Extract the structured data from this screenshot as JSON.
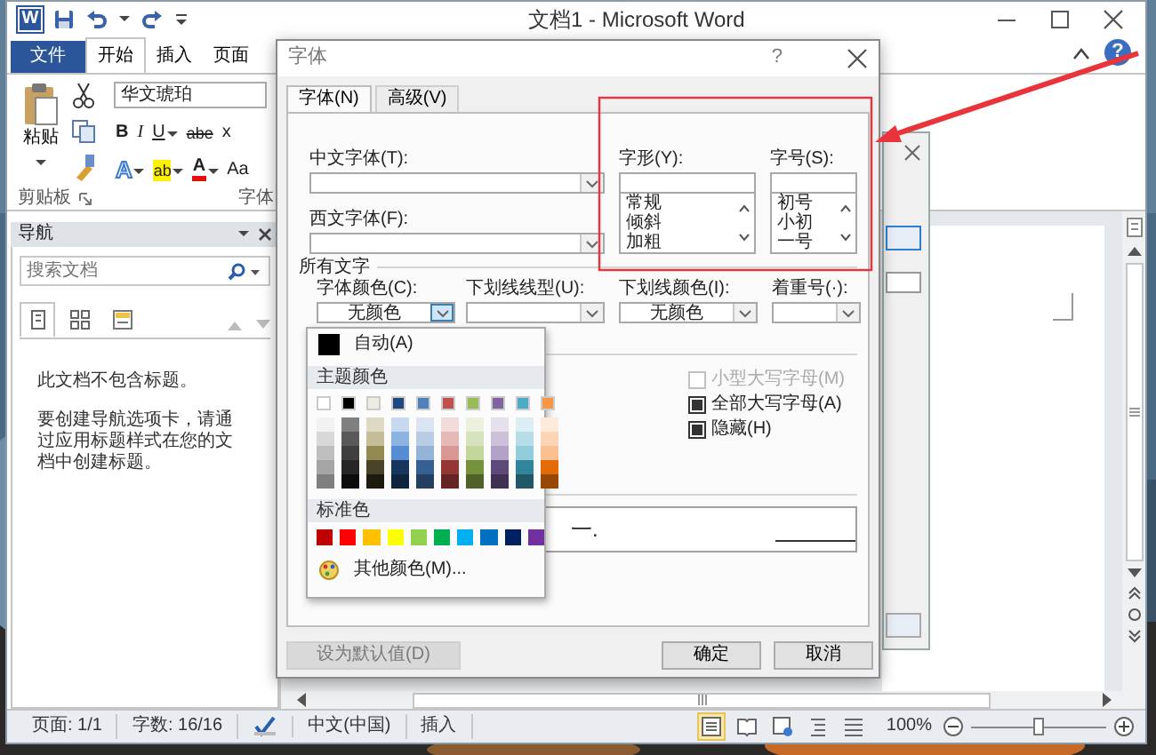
{
  "window": {
    "app_badge": "W",
    "title": "文档1 - Microsoft Word"
  },
  "ribbon_tabs": [
    {
      "label": "文件",
      "kind": "file",
      "selected": false
    },
    {
      "label": "开始",
      "kind": "tab",
      "selected": true
    },
    {
      "label": "插入",
      "kind": "tab",
      "selected": false
    },
    {
      "label": "页面",
      "kind": "tab",
      "selected": false
    }
  ],
  "ribbon": {
    "help": "?",
    "paste_label": "粘贴",
    "font_name": "华文琥珀",
    "format_row1": [
      {
        "kind": "bold",
        "text": "B",
        "menu": false
      },
      {
        "kind": "italic",
        "text": "I",
        "menu": false
      },
      {
        "kind": "underline",
        "text": "U",
        "menu": true
      },
      {
        "kind": "strike",
        "text": "abe",
        "menu": false
      },
      {
        "kind": "plain",
        "text": "x",
        "menu": false
      }
    ],
    "format_row2": [
      {
        "kind": "effects",
        "text": "A",
        "menu": true
      },
      {
        "kind": "highlight",
        "text": "ab",
        "menu": true
      },
      {
        "kind": "color",
        "text": "A",
        "menu": true
      },
      {
        "kind": "plain",
        "text": "Aa",
        "menu": false
      }
    ],
    "groups": [
      "剪贴板",
      "字体"
    ]
  },
  "navigation": {
    "title": "导航",
    "search_placeholder": "搜索文档",
    "tabs": [
      {
        "kind": "headings",
        "selected": true
      },
      {
        "kind": "pages",
        "selected": false
      },
      {
        "kind": "results",
        "selected": false
      }
    ],
    "messages": [
      "此文档不包含标题。",
      "要创建导航选项卡，请通过应用标题样式在您的文档中创建标题。"
    ]
  },
  "font_dialog": {
    "title": "字体",
    "help": "?",
    "tabs": [
      {
        "label": "字体(N)",
        "selected": true
      },
      {
        "label": "高级(V)",
        "selected": false
      }
    ],
    "chinese_font": {
      "label": "中文字体(T):"
    },
    "western_font": {
      "label": "西文字体(F):"
    },
    "style": {
      "label": "字形(Y):",
      "options": [
        "常规",
        "倾斜",
        "加粗"
      ]
    },
    "size": {
      "label": "字号(S):",
      "options": [
        "初号",
        "小初",
        "一号"
      ]
    },
    "all_text": {
      "heading": "所有文字",
      "controls": [
        {
          "label": "字体颜色(C):",
          "value": "无颜色",
          "focused": true
        },
        {
          "label": "下划线线型(U):",
          "focused": false
        },
        {
          "label": "下划线颜色(I):",
          "value": "无颜色",
          "focused": false
        },
        {
          "label": "着重号(·):",
          "focused": false
        }
      ]
    },
    "effects": {
      "checkboxes": [
        {
          "label": "小型大写字母(M)",
          "checked": false,
          "disabled": true
        },
        {
          "label": "全部大写字母(A)",
          "checked": true,
          "disabled": false
        },
        {
          "label": "隐藏(H)",
          "checked": true,
          "disabled": false
        }
      ]
    },
    "preview": {
      "sample": "一."
    },
    "buttons": [
      {
        "label": "设为默认值(D)",
        "disabled": true
      },
      {
        "label": "确定",
        "disabled": false
      },
      {
        "label": "取消",
        "disabled": false
      }
    ]
  },
  "color_menu": {
    "automatic": {
      "label": "自动(A)",
      "color": "#000000"
    },
    "theme_heading": "主题颜色",
    "theme_colors": [
      {
        "color": "#ffffff",
        "shades": [
          {
            "color": "#f2f2f2"
          },
          {
            "color": "#d8d8d8"
          },
          {
            "color": "#bfbfbf"
          },
          {
            "color": "#a5a5a5"
          },
          {
            "color": "#7f7f7f"
          }
        ]
      },
      {
        "color": "#000000",
        "shades": [
          {
            "color": "#7f7f7f"
          },
          {
            "color": "#595959"
          },
          {
            "color": "#3f3f3f"
          },
          {
            "color": "#262626"
          },
          {
            "color": "#0c0c0c"
          }
        ]
      },
      {
        "color": "#eeece1",
        "shades": [
          {
            "color": "#ddd9c3"
          },
          {
            "color": "#c4bd97"
          },
          {
            "color": "#938953"
          },
          {
            "color": "#494429"
          },
          {
            "color": "#1d1b10"
          }
        ]
      },
      {
        "color": "#1f497d",
        "shades": [
          {
            "color": "#c6d9f0"
          },
          {
            "color": "#8db3e2"
          },
          {
            "color": "#548dd4"
          },
          {
            "color": "#17365d"
          },
          {
            "color": "#0f243e"
          }
        ]
      },
      {
        "color": "#4f81bd",
        "shades": [
          {
            "color": "#dbe5f1"
          },
          {
            "color": "#b8cce4"
          },
          {
            "color": "#95b3d7"
          },
          {
            "color": "#366092"
          },
          {
            "color": "#244061"
          }
        ]
      },
      {
        "color": "#c0504d",
        "shades": [
          {
            "color": "#f2dcdb"
          },
          {
            "color": "#e5b9b7"
          },
          {
            "color": "#d99694"
          },
          {
            "color": "#953734"
          },
          {
            "color": "#632423"
          }
        ]
      },
      {
        "color": "#9bbb59",
        "shades": [
          {
            "color": "#ebf1dd"
          },
          {
            "color": "#d7e3bc"
          },
          {
            "color": "#c3d69b"
          },
          {
            "color": "#76923c"
          },
          {
            "color": "#4f6128"
          }
        ]
      },
      {
        "color": "#8064a2",
        "shades": [
          {
            "color": "#e5e0ec"
          },
          {
            "color": "#ccc1d9"
          },
          {
            "color": "#b2a2c7"
          },
          {
            "color": "#5f497a"
          },
          {
            "color": "#3f3151"
          }
        ]
      },
      {
        "color": "#4bacc6",
        "shades": [
          {
            "color": "#dbeef3"
          },
          {
            "color": "#b7dde8"
          },
          {
            "color": "#92cddc"
          },
          {
            "color": "#31859b"
          },
          {
            "color": "#205867"
          }
        ]
      },
      {
        "color": "#f79646",
        "shades": [
          {
            "color": "#fdeada"
          },
          {
            "color": "#fbd5b5"
          },
          {
            "color": "#fac08f"
          },
          {
            "color": "#e36c09"
          },
          {
            "color": "#974806"
          }
        ]
      }
    ],
    "standard_heading": "标准色",
    "standard_colors": [
      {
        "color": "#c00000"
      },
      {
        "color": "#ff0000"
      },
      {
        "color": "#ffc000"
      },
      {
        "color": "#ffff00"
      },
      {
        "color": "#92d050"
      },
      {
        "color": "#00b050"
      },
      {
        "color": "#00b0f0"
      },
      {
        "color": "#0070c0"
      },
      {
        "color": "#002060"
      },
      {
        "color": "#7030a0"
      }
    ],
    "more_label": "其他颜色(M)..."
  },
  "status_bar": {
    "items": [
      {
        "kind": "text",
        "text": "页面: 1/1"
      },
      {
        "kind": "text",
        "text": "字数: 16/16"
      },
      {
        "kind": "proofing"
      },
      {
        "kind": "text",
        "text": "中文(中国)"
      },
      {
        "kind": "text",
        "text": "插入"
      }
    ],
    "views": [
      {
        "kind": "print",
        "selected": true
      },
      {
        "kind": "reading",
        "selected": false
      },
      {
        "kind": "web",
        "selected": false
      },
      {
        "kind": "outline",
        "selected": false
      },
      {
        "kind": "draft",
        "selected": false
      }
    ],
    "zoom": "100%",
    "zoom_slider": {
      "level": 0.5
    }
  },
  "callout": {
    "color": "#e8343a"
  }
}
